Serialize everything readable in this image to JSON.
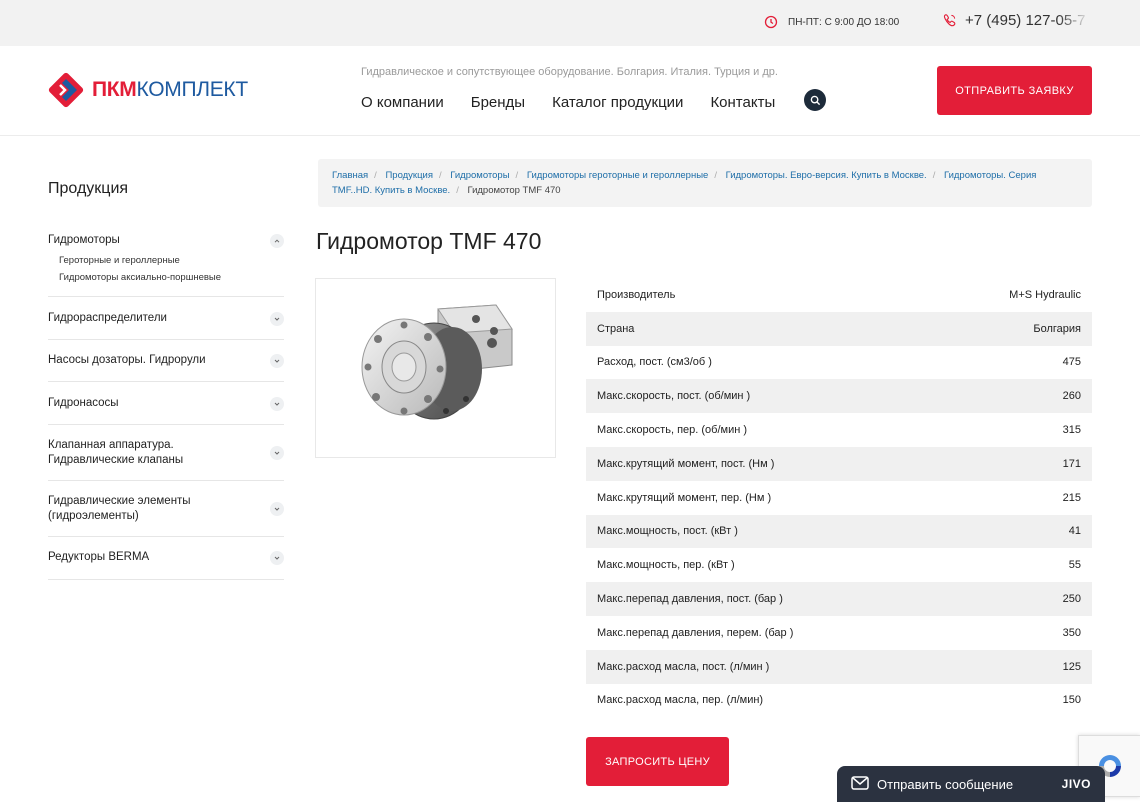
{
  "topbar": {
    "hours": "ПН-ПТ: С 9:00 ДО 18:00",
    "phone_main": "+7 (495) ",
    "phone_fade": "127-05-7"
  },
  "header": {
    "logo_part1": "ПКМ",
    "logo_part2": "КОМПЛЕКТ",
    "tagline": "Гидравлическое и сопутствующее оборудование. Болгария. Италия. Турция и др.",
    "nav": [
      "О компании",
      "Бренды",
      "Каталог продукции",
      "Контакты"
    ],
    "request_button": "ОТПРАВИТЬ ЗАЯВКУ"
  },
  "sidebar": {
    "title": "Продукция",
    "items": [
      {
        "label": "Гидромоторы",
        "expanded": true,
        "children": [
          "Героторные и героллерные",
          "Гидромоторы аксиально-поршневые"
        ]
      },
      {
        "label": "Гидрораспределители",
        "expanded": false
      },
      {
        "label": "Насосы дозаторы. Гидрорули",
        "expanded": false
      },
      {
        "label": "Гидронасосы",
        "expanded": false
      },
      {
        "label": "Клапанная аппаратура. Гидравлические клапаны",
        "expanded": false
      },
      {
        "label": "Гидравлические элементы (гидроэлементы)",
        "expanded": false
      },
      {
        "label": "Редукторы BERMA",
        "expanded": false
      }
    ]
  },
  "breadcrumb": {
    "links": [
      "Главная",
      "Продукция",
      "Гидромоторы",
      "Гидромоторы героторные и героллерные",
      "Гидромоторы. Евро-версия. Купить в Москве.",
      "Гидромоторы. Серия TMF..HD. Купить в Москве."
    ],
    "current": "Гидромотор TMF 470"
  },
  "product": {
    "title": "Гидромотор TMF 470",
    "specs": [
      {
        "name": "Производитель",
        "value": "M+S Hydraulic"
      },
      {
        "name": "Страна",
        "value": "Болгария"
      },
      {
        "name": "Расход, пост. (см3/об )",
        "value": "475"
      },
      {
        "name": "Макс.скорость, пост. (об/мин )",
        "value": "260"
      },
      {
        "name": "Макс.скорость, пер. (об/мин )",
        "value": "315"
      },
      {
        "name": "Макс.крутящий момент, пост. (Нм )",
        "value": "171"
      },
      {
        "name": "Макс.крутящий момент, пер. (Нм )",
        "value": "215"
      },
      {
        "name": "Макс.мощность, пост. (кВт )",
        "value": "41"
      },
      {
        "name": "Макс.мощность, пер. (кВт )",
        "value": "55"
      },
      {
        "name": "Макс.перепад давления, пост. (бар )",
        "value": "250"
      },
      {
        "name": "Макс.перепад давления, перем. (бар )",
        "value": "350"
      },
      {
        "name": "Макс.расход масла, пост. (л/мин )",
        "value": "125"
      },
      {
        "name": "Макс.расход масла, пер. (л/мин)",
        "value": "150"
      }
    ],
    "price_button": "ЗАПРОСИТЬ ЦЕНУ"
  },
  "chat": {
    "label": "Отправить сообщение",
    "brand": "JIVO"
  },
  "colors": {
    "accent_red": "#e31e38",
    "brand_blue": "#1e5aa0",
    "link_blue": "#1e6ea8",
    "dark": "#2b3240"
  }
}
